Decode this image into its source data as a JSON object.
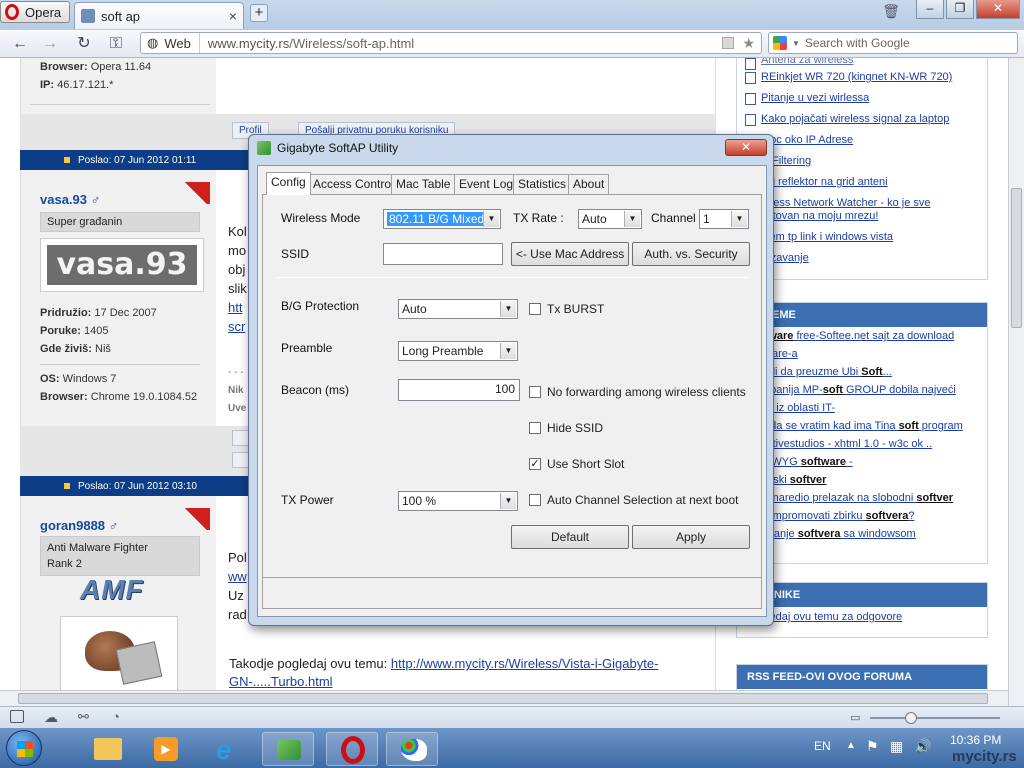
{
  "browser": {
    "menu_label": "Opera",
    "tab_title": "soft ap",
    "tab_close": "×",
    "new_tab": "+",
    "web_label": "Web",
    "url_domain": "www.mycity.rs",
    "url_path": "/Wireless/soft-ap.html",
    "search_placeholder": "Search with Google",
    "window_buttons": [
      "–",
      "❐",
      "✕"
    ]
  },
  "page": {
    "post1": {
      "browser_label": "Browser:",
      "browser_value": "Opera 11.64",
      "ip_label": "IP:",
      "ip_value": "46.17.121.*",
      "btn_profile": "Profil",
      "btn_pm": "Pošalji privatnu poruku korisniku"
    },
    "post2": {
      "header": "Poslao: 07 Jun 2012 01:11",
      "username": "vasa.93 ♂",
      "rank": "Super građanin",
      "avatar_text": "vasa.93",
      "joined_label": "Pridružio:",
      "joined_value": "17 Dec 2007",
      "posts_label": "Poruke:",
      "posts_value": "1405",
      "location_label": "Gde živiš:",
      "location_value": "Niš",
      "os_label": "OS:",
      "os_value": "Windows 7",
      "browser_label": "Browser:",
      "browser_value": "Chrome 19.0.1084.52",
      "text_fragments": [
        "Kol",
        "mo",
        "obj",
        "slik",
        "htt",
        "scr",
        "- - -",
        "Nik",
        "Uve"
      ]
    },
    "post3": {
      "header": "Poslao: 07 Jun 2012 03:10",
      "username": "goran9888 ♂",
      "rank1": "Anti Malware Fighter",
      "rank2": "Rank 2",
      "logo_text": "AMF",
      "text_fragments": [
        "Pol",
        "ww",
        "Uz",
        "rad"
      ],
      "bottom_text": "Takodje pogledaj ovu temu:",
      "link": "http://www.mycity.rs/Wireless/Vista-i-Gigabyte-GN-.....Turbo.html"
    },
    "sidebar": {
      "top_items": [
        "REinkjet WR 720 (kingnet KN-WR 720)",
        "Pitanje u vezi wirlessa",
        "Kako pojačati wireless signal za laptop",
        "moc oko IP Adrese",
        "C Filtering",
        "ol i reflektor na grid anteni",
        "reless Network Watcher - ko je sve ektovan na moju mrezu!",
        "blem tp link i windows vista",
        "rezavanje"
      ],
      "top_item_partial": "Antena za wireless",
      "box2_title": "NE TEME",
      "box2_items": [
        {
          "pre": "",
          "bold": "ftware",
          "post": " free-Softee.net sajt za download"
        },
        {
          "pre": "tware-a",
          "bold": "",
          "post": ""
        },
        {
          "pre": "zeli da preuzme Ubi ",
          "bold": "Soft",
          "post": "..."
        },
        {
          "pre": "mpanija MP-",
          "bold": "soft",
          "post": " GROUP dobila najveći"
        },
        {
          "pre": "ao iz oblasti IT-",
          "bold": "",
          "post": ""
        },
        {
          "pre": "o da se vratim kad ima Tina ",
          "bold": "soft",
          "post": " program"
        },
        {
          "pre": "ectivestudios - xhtml 1.0 - w3c ok ..",
          "bold": "",
          "post": ""
        },
        {
          "pre": "SIWYG ",
          "bold": "software",
          "post": " -"
        },
        {
          "pre": "unski ",
          "bold": "softver",
          "post": ""
        },
        {
          "pre": "in naredio prelazak na slobodni ",
          "bold": "softver",
          "post": ""
        },
        {
          "pre": " kompromovati zbirku ",
          "bold": "softvera",
          "post": "?"
        },
        {
          "pre": "retanje ",
          "bold": "softvera",
          "post": " sa windowsom"
        }
      ],
      "box3_title": "ORISNIKE",
      "box3_item": "gledaj ovu temu za odgovore",
      "box4_title": "RSS FEED-OVI OVOG FORUMA"
    }
  },
  "dialog": {
    "title": "Gigabyte SoftAP Utility",
    "close": "✕",
    "tabs": [
      "Config",
      "Access Control",
      "Mac Table",
      "Event Log",
      "Statistics",
      "About"
    ],
    "wireless_mode_label": "Wireless Mode",
    "wireless_mode_value": "802.11 B/G Mixed",
    "tx_rate_label": "TX Rate :",
    "tx_rate_value": "Auto",
    "channel_label": "Channel",
    "channel_value": "1",
    "ssid_label": "SSID",
    "ssid_value": "",
    "use_mac_btn": "<- Use Mac Address",
    "auth_btn": "Auth. vs. Security",
    "bg_protection_label": "B/G Protection",
    "bg_protection_value": "Auto",
    "tx_burst_label": "Tx BURST",
    "preamble_label": "Preamble",
    "preamble_value": "Long Preamble",
    "beacon_label": "Beacon (ms)",
    "beacon_value": "100",
    "no_forward_label": "No forwarding among wireless clients",
    "hide_ssid_label": "Hide SSID",
    "short_slot_label": "Use Short Slot",
    "tx_power_label": "TX Power",
    "tx_power_value": "100 %",
    "auto_channel_label": "Auto Channel Selection at next boot",
    "default_btn": "Default",
    "apply_btn": "Apply",
    "checkbox_states": {
      "tx_burst": false,
      "no_forward": false,
      "hide_ssid": false,
      "short_slot": true,
      "auto_channel": false
    }
  },
  "taskbar": {
    "lang": "EN",
    "time": "10:36 PM",
    "watermark": "mycity.rs"
  }
}
